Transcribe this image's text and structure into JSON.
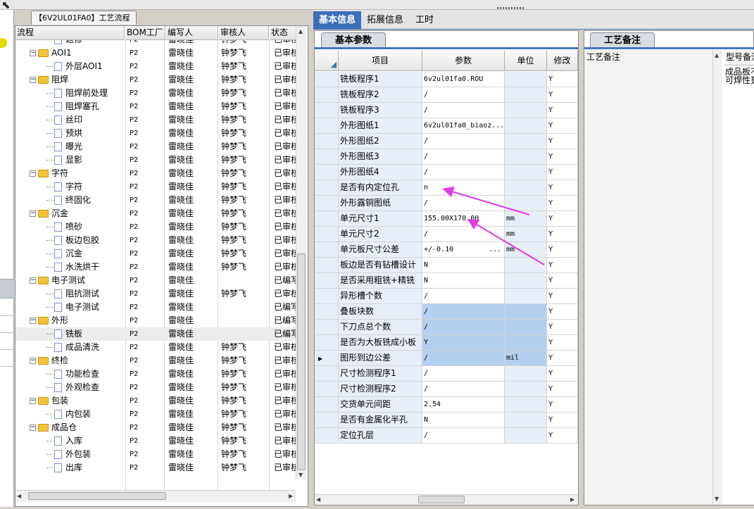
{
  "left_panel": {
    "tab_title": "【6V2UL01FA0】工艺流程",
    "columns": [
      "流程",
      "BOM工厂",
      "编写人",
      "审核人",
      "状态"
    ],
    "rows": [
      {
        "level": 2,
        "kind": "leaf",
        "name": "返修",
        "bom": "P2",
        "writer": "雷晓佳",
        "reviewer": "钟梦飞",
        "status": "已审核"
      },
      {
        "level": 1,
        "kind": "folder",
        "name": "AOI1",
        "bom": "P2",
        "writer": "雷晓佳",
        "reviewer": "钟梦飞",
        "status": "已审核"
      },
      {
        "level": 2,
        "kind": "leaf",
        "name": "外层AOI1",
        "bom": "P2",
        "writer": "雷晓佳",
        "reviewer": "钟梦飞",
        "status": "已审核"
      },
      {
        "level": 1,
        "kind": "folder",
        "name": "阻焊",
        "bom": "P2",
        "writer": "雷晓佳",
        "reviewer": "钟梦飞",
        "status": "已审核"
      },
      {
        "level": 2,
        "kind": "leaf",
        "name": "阻焊前处理",
        "bom": "P2",
        "writer": "雷晓佳",
        "reviewer": "钟梦飞",
        "status": "已审核"
      },
      {
        "level": 2,
        "kind": "leaf",
        "name": "阻焊塞孔",
        "bom": "P2",
        "writer": "雷晓佳",
        "reviewer": "钟梦飞",
        "status": "已审核"
      },
      {
        "level": 2,
        "kind": "leaf",
        "name": "丝印",
        "bom": "P2",
        "writer": "雷晓佳",
        "reviewer": "钟梦飞",
        "status": "已审核"
      },
      {
        "level": 2,
        "kind": "leaf",
        "name": "预烘",
        "bom": "P2",
        "writer": "雷晓佳",
        "reviewer": "钟梦飞",
        "status": "已审核"
      },
      {
        "level": 2,
        "kind": "leaf",
        "name": "曝光",
        "bom": "P2",
        "writer": "雷晓佳",
        "reviewer": "钟梦飞",
        "status": "已审核"
      },
      {
        "level": 2,
        "kind": "leaf",
        "name": "显影",
        "bom": "P2",
        "writer": "雷晓佳",
        "reviewer": "钟梦飞",
        "status": "已审核"
      },
      {
        "level": 1,
        "kind": "folder",
        "name": "字符",
        "bom": "P2",
        "writer": "雷晓佳",
        "reviewer": "钟梦飞",
        "status": "已审核"
      },
      {
        "level": 2,
        "kind": "leaf",
        "name": "字符",
        "bom": "P2",
        "writer": "雷晓佳",
        "reviewer": "钟梦飞",
        "status": "已审核"
      },
      {
        "level": 2,
        "kind": "leaf",
        "name": "终固化",
        "bom": "P2",
        "writer": "雷晓佳",
        "reviewer": "钟梦飞",
        "status": "已审核"
      },
      {
        "level": 1,
        "kind": "folder",
        "name": "沉金",
        "bom": "P2",
        "writer": "雷晓佳",
        "reviewer": "钟梦飞",
        "status": "已审核"
      },
      {
        "level": 2,
        "kind": "leaf",
        "name": "喷砂",
        "bom": "P2",
        "writer": "雷晓佳",
        "reviewer": "钟梦飞",
        "status": "已审核"
      },
      {
        "level": 2,
        "kind": "leaf",
        "name": "板边包胶",
        "bom": "P2",
        "writer": "雷晓佳",
        "reviewer": "钟梦飞",
        "status": "已审核"
      },
      {
        "level": 2,
        "kind": "leaf",
        "name": "沉金",
        "bom": "P2",
        "writer": "雷晓佳",
        "reviewer": "钟梦飞",
        "status": "已审核"
      },
      {
        "level": 2,
        "kind": "leaf",
        "name": "水洗烘干",
        "bom": "P2",
        "writer": "雷晓佳",
        "reviewer": "钟梦飞",
        "status": "已审核"
      },
      {
        "level": 1,
        "kind": "folder",
        "name": "电子测试",
        "bom": "P2",
        "writer": "雷晓佳",
        "reviewer": "",
        "status": "已编写"
      },
      {
        "level": 2,
        "kind": "leaf",
        "name": "阻抗测试",
        "bom": "P2",
        "writer": "雷晓佳",
        "reviewer": "钟梦飞",
        "status": "已审核"
      },
      {
        "level": 2,
        "kind": "leaf",
        "name": "电子测试",
        "bom": "P2",
        "writer": "雷晓佳",
        "reviewer": "",
        "status": "已编写"
      },
      {
        "level": 1,
        "kind": "folder",
        "name": "外形",
        "bom": "P2",
        "writer": "雷晓佳",
        "reviewer": "",
        "status": "已编写"
      },
      {
        "level": 2,
        "kind": "leaf",
        "name": "铣板",
        "bom": "P2",
        "writer": "雷晓佳",
        "reviewer": "",
        "status": "已编写",
        "selected": true
      },
      {
        "level": 2,
        "kind": "leaf",
        "name": "成品清洗",
        "bom": "P2",
        "writer": "雷晓佳",
        "reviewer": "钟梦飞",
        "status": "已审核"
      },
      {
        "level": 1,
        "kind": "folder",
        "name": "终检",
        "bom": "P2",
        "writer": "雷晓佳",
        "reviewer": "钟梦飞",
        "status": "已审核"
      },
      {
        "level": 2,
        "kind": "leaf",
        "name": "功能检查",
        "bom": "P2",
        "writer": "雷晓佳",
        "reviewer": "钟梦飞",
        "status": "已审核"
      },
      {
        "level": 2,
        "kind": "leaf",
        "name": "外观检查",
        "bom": "P2",
        "writer": "雷晓佳",
        "reviewer": "钟梦飞",
        "status": "已审核"
      },
      {
        "level": 1,
        "kind": "folder",
        "name": "包装",
        "bom": "P2",
        "writer": "雷晓佳",
        "reviewer": "钟梦飞",
        "status": "已审核"
      },
      {
        "level": 2,
        "kind": "leaf",
        "name": "内包装",
        "bom": "P2",
        "writer": "雷晓佳",
        "reviewer": "钟梦飞",
        "status": "已审核"
      },
      {
        "level": 1,
        "kind": "folder",
        "name": "成品仓",
        "bom": "P2",
        "writer": "雷晓佳",
        "reviewer": "钟梦飞",
        "status": "已审核"
      },
      {
        "level": 2,
        "kind": "leaf",
        "name": "入库",
        "bom": "P2",
        "writer": "雷晓佳",
        "reviewer": "钟梦飞",
        "status": "已审核"
      },
      {
        "level": 2,
        "kind": "leaf",
        "name": "外包装",
        "bom": "P2",
        "writer": "雷晓佳",
        "reviewer": "钟梦飞",
        "status": "已审核"
      },
      {
        "level": 2,
        "kind": "leaf",
        "name": "出库",
        "bom": "P2",
        "writer": "雷晓佳",
        "reviewer": "钟梦飞",
        "status": "已审核"
      }
    ]
  },
  "right_tabs": {
    "tabs": [
      "基本信息",
      "拓展信息",
      "工时"
    ],
    "active": 0
  },
  "basic_params": {
    "subtab": "基本参数",
    "columns": [
      "项目",
      "参数",
      "单位",
      "修改"
    ],
    "rows": [
      {
        "name": "铣板程序1",
        "value": "6v2ul01fa0.ROU",
        "unit": "",
        "mod": "Y"
      },
      {
        "name": "铣板程序2",
        "value": "/",
        "unit": "",
        "mod": "Y"
      },
      {
        "name": "铣板程序3",
        "value": "/",
        "unit": "",
        "mod": "Y"
      },
      {
        "name": "外形图纸1",
        "value": "6v2ul01fa0_biaoz...",
        "unit": "",
        "mod": "Y"
      },
      {
        "name": "外形图纸2",
        "value": "/",
        "unit": "",
        "mod": "Y"
      },
      {
        "name": "外形图纸3",
        "value": "/",
        "unit": "",
        "mod": "Y"
      },
      {
        "name": "外形图纸4",
        "value": "/",
        "unit": "",
        "mod": "Y"
      },
      {
        "name": "是否有内定位孔",
        "value": "n",
        "unit": "",
        "mod": "Y"
      },
      {
        "name": "外形露铜图纸",
        "value": "/",
        "unit": "",
        "mod": "Y"
      },
      {
        "name": "单元尺寸1",
        "value": "155.00X170.00",
        "unit": "mm",
        "mod": "Y"
      },
      {
        "name": "单元尺寸2",
        "value": "/",
        "unit": "mm",
        "mod": "Y"
      },
      {
        "name": "单元板尺寸公差",
        "value": "+/-0.10",
        "unit": "mm",
        "mod": "Y",
        "ellipsis": "..."
      },
      {
        "name": "板边是否有钻槽设计",
        "value": "N",
        "unit": "",
        "mod": "Y"
      },
      {
        "name": "是否采用粗铣+精铣",
        "value": "N",
        "unit": "",
        "mod": "Y"
      },
      {
        "name": "异形槽个数",
        "value": "/",
        "unit": "",
        "mod": "Y"
      },
      {
        "name": "叠板块数",
        "value": "/",
        "unit": "",
        "mod": "Y",
        "hl": "value"
      },
      {
        "name": "下刀点总个数",
        "value": "/",
        "unit": "",
        "mod": "Y",
        "hl": "value"
      },
      {
        "name": "是否为大板铣成小板",
        "value": "Y",
        "unit": "",
        "mod": "Y",
        "hl": "value"
      },
      {
        "name": "图形到边公差",
        "value": "/",
        "unit": "mil",
        "mod": "Y",
        "hl": "value",
        "current": true
      },
      {
        "name": "尺寸检测程序1",
        "value": "/",
        "unit": "",
        "mod": "Y"
      },
      {
        "name": "尺寸检测程序2",
        "value": "/",
        "unit": "",
        "mod": "Y"
      },
      {
        "name": "交货单元间距",
        "value": "2.54",
        "unit": "",
        "mod": "Y"
      },
      {
        "name": "是否有金属化半孔",
        "value": "N",
        "unit": "",
        "mod": "Y"
      },
      {
        "name": "定位孔层",
        "value": "/",
        "unit": "",
        "mod": "Y"
      }
    ]
  },
  "notes": {
    "subtab": "工艺备注",
    "col1": "工艺备注",
    "col2": "型号备注",
    "text_line1": "成品板不",
    "text_line2": "可焊性更"
  },
  "annotation_color": "#e13be2"
}
